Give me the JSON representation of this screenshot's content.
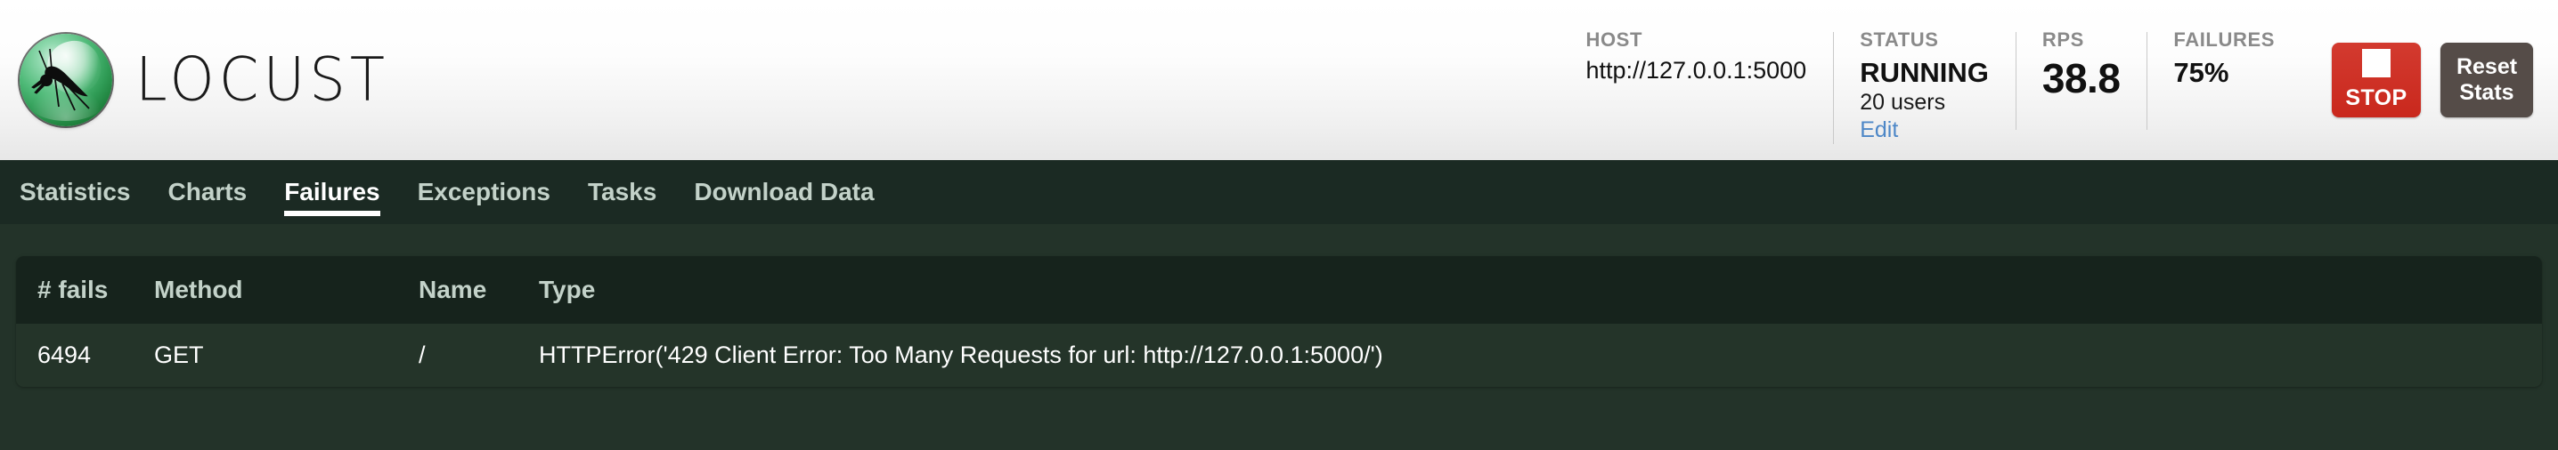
{
  "app": {
    "brand": "LOCUST",
    "logo_icon": "locust-mosquito-logo"
  },
  "header": {
    "stats": [
      {
        "label": "HOST",
        "value": "http://127.0.0.1:5000",
        "style": "plain"
      },
      {
        "label": "STATUS",
        "value": "RUNNING",
        "style": "bold",
        "sub": "20 users",
        "link": "Edit"
      },
      {
        "label": "RPS",
        "value": "38.8",
        "style": "big"
      },
      {
        "label": "FAILURES",
        "value": "75%",
        "style": "bold"
      }
    ],
    "buttons": {
      "stop": {
        "label": "STOP",
        "icon": "stop-square-icon",
        "color": "#c9281d"
      },
      "reset": {
        "label_line1": "Reset",
        "label_line2": "Stats",
        "color": "#554c48"
      }
    }
  },
  "nav": {
    "tabs": [
      {
        "label": "Statistics",
        "active": false
      },
      {
        "label": "Charts",
        "active": false
      },
      {
        "label": "Failures",
        "active": true
      },
      {
        "label": "Exceptions",
        "active": false
      },
      {
        "label": "Tasks",
        "active": false
      },
      {
        "label": "Download Data",
        "active": false
      }
    ]
  },
  "table": {
    "columns": [
      "# fails",
      "Method",
      "Name",
      "Type"
    ],
    "rows": [
      {
        "fails": "6494",
        "method": "GET",
        "name": "/",
        "type": "HTTPError('429 Client Error: Too Many Requests for url: http://127.0.0.1:5000/')"
      }
    ]
  }
}
